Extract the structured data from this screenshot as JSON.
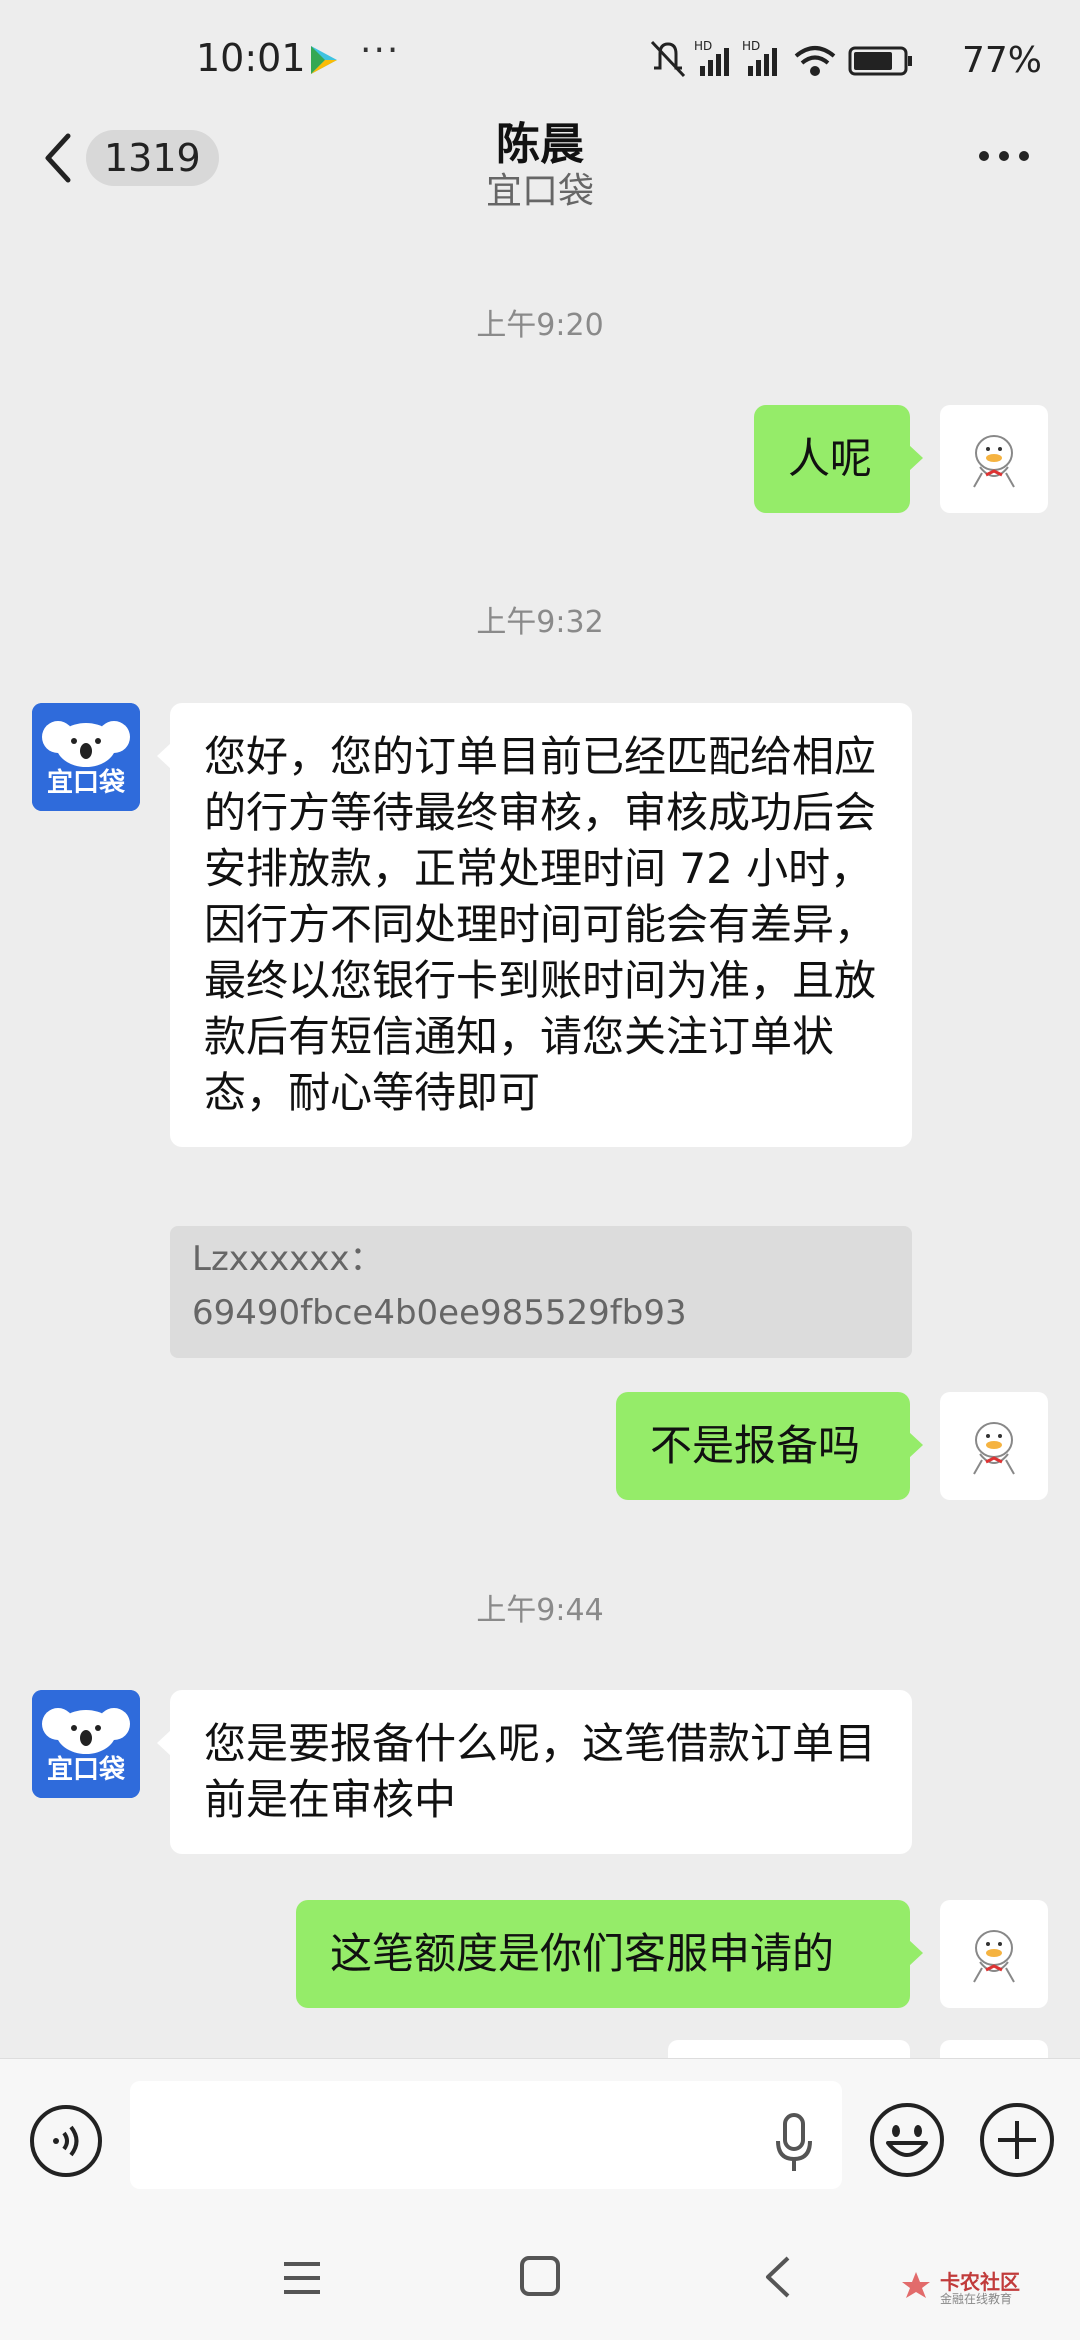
{
  "status_bar": {
    "time": "10:01",
    "battery": "77%"
  },
  "header": {
    "unread_count": "1319",
    "title": "陈晨",
    "subtitle": "宜口袋"
  },
  "bot_avatar_text": "宜口袋",
  "messages": [
    {
      "timestamp": "上午9:20"
    },
    {
      "from": "me",
      "text": "人呢"
    },
    {
      "timestamp": "上午9:32"
    },
    {
      "from": "other",
      "text": "您好，您的订单目前已经匹配给相应的行方等待最终审核，审核成功后会安排放款，正常处理时间 72 小时，因行方不同处理时间可能会有差异，最终以您银行卡到账时间为准，且放款后有短信通知，请您关注订单状态，耐心等待即可"
    },
    {
      "quote_line1": "Lzxxxxxx：",
      "quote_line2": "69490fbce4b0ee985529fb93"
    },
    {
      "from": "me",
      "text": "不是报备吗"
    },
    {
      "timestamp": "上午9:44"
    },
    {
      "from": "other",
      "text": "您是要报备什么呢，这笔借款订单目前是在审核中"
    },
    {
      "from": "me",
      "text": "这笔额度是你们客服申请的"
    }
  ],
  "input": {
    "value": "",
    "placeholder": ""
  },
  "watermark": {
    "line1": "卡农社区",
    "line2": "金融在线教育"
  },
  "colors": {
    "sent_bubble": "#95ec69",
    "received_bubble": "#ffffff",
    "background": "#ededed",
    "bot_avatar": "#2f6bdb"
  }
}
